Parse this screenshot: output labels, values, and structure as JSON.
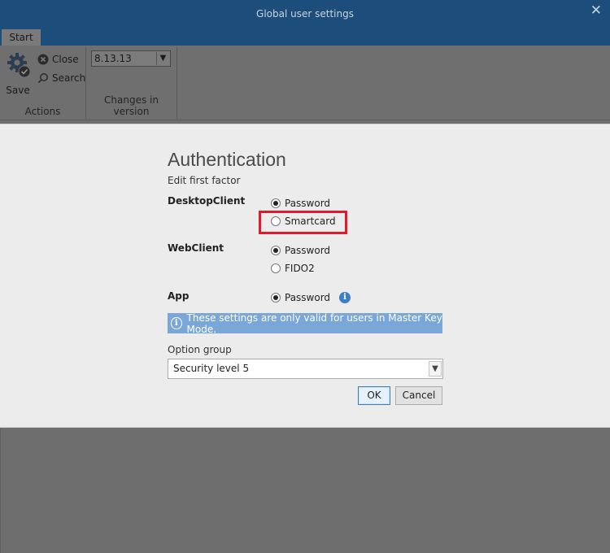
{
  "window": {
    "title": "Global user settings",
    "close_glyph": "✕"
  },
  "ribbon": {
    "tabs": [
      {
        "label": "Start"
      }
    ],
    "actions": {
      "save_label": "Save",
      "close_label": "Close",
      "search_label": "Search",
      "group_label": "Actions"
    },
    "version": {
      "selected": "8.13.13",
      "group_label": "Changes in version"
    }
  },
  "dialog": {
    "title": "Authentication",
    "subtitle": "Edit first factor",
    "desktop": {
      "label": "DesktopClient",
      "options": [
        {
          "label": "Password",
          "selected": true
        },
        {
          "label": "Smartcard",
          "selected": false
        }
      ]
    },
    "web": {
      "label": "WebClient",
      "options": [
        {
          "label": "Password",
          "selected": true
        },
        {
          "label": "FIDO2",
          "selected": false
        }
      ]
    },
    "app": {
      "label": "App",
      "options": [
        {
          "label": "Password",
          "selected": true
        }
      ]
    },
    "info_text": "These settings are only valid for users in Master Key Mode.",
    "option_group": {
      "label": "Option group",
      "selected": "Security level 5"
    },
    "ok_label": "OK",
    "cancel_label": "Cancel"
  },
  "colors": {
    "titlebar": "#1d4d7a",
    "info_bar": "#7aa7d8",
    "highlight": "#e0192b"
  }
}
